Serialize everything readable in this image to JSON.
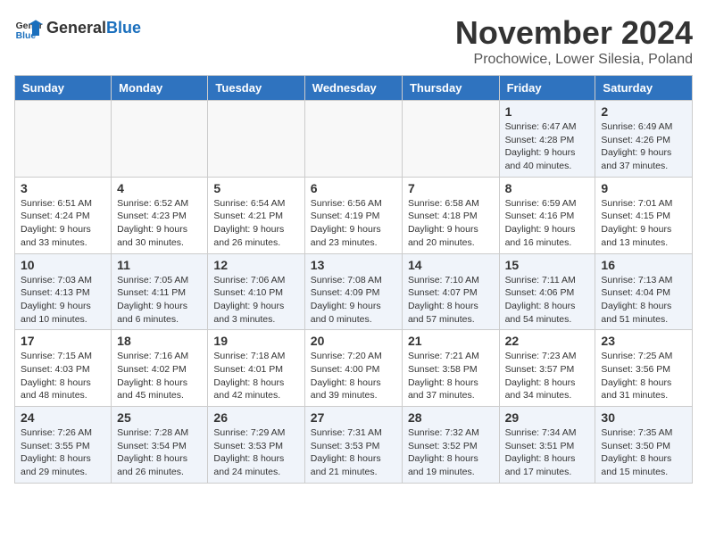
{
  "header": {
    "logo_line1": "General",
    "logo_line2": "Blue",
    "month": "November 2024",
    "location": "Prochowice, Lower Silesia, Poland"
  },
  "weekdays": [
    "Sunday",
    "Monday",
    "Tuesday",
    "Wednesday",
    "Thursday",
    "Friday",
    "Saturday"
  ],
  "weeks": [
    [
      {
        "day": "",
        "info": ""
      },
      {
        "day": "",
        "info": ""
      },
      {
        "day": "",
        "info": ""
      },
      {
        "day": "",
        "info": ""
      },
      {
        "day": "",
        "info": ""
      },
      {
        "day": "1",
        "info": "Sunrise: 6:47 AM\nSunset: 4:28 PM\nDaylight: 9 hours\nand 40 minutes."
      },
      {
        "day": "2",
        "info": "Sunrise: 6:49 AM\nSunset: 4:26 PM\nDaylight: 9 hours\nand 37 minutes."
      }
    ],
    [
      {
        "day": "3",
        "info": "Sunrise: 6:51 AM\nSunset: 4:24 PM\nDaylight: 9 hours\nand 33 minutes."
      },
      {
        "day": "4",
        "info": "Sunrise: 6:52 AM\nSunset: 4:23 PM\nDaylight: 9 hours\nand 30 minutes."
      },
      {
        "day": "5",
        "info": "Sunrise: 6:54 AM\nSunset: 4:21 PM\nDaylight: 9 hours\nand 26 minutes."
      },
      {
        "day": "6",
        "info": "Sunrise: 6:56 AM\nSunset: 4:19 PM\nDaylight: 9 hours\nand 23 minutes."
      },
      {
        "day": "7",
        "info": "Sunrise: 6:58 AM\nSunset: 4:18 PM\nDaylight: 9 hours\nand 20 minutes."
      },
      {
        "day": "8",
        "info": "Sunrise: 6:59 AM\nSunset: 4:16 PM\nDaylight: 9 hours\nand 16 minutes."
      },
      {
        "day": "9",
        "info": "Sunrise: 7:01 AM\nSunset: 4:15 PM\nDaylight: 9 hours\nand 13 minutes."
      }
    ],
    [
      {
        "day": "10",
        "info": "Sunrise: 7:03 AM\nSunset: 4:13 PM\nDaylight: 9 hours\nand 10 minutes."
      },
      {
        "day": "11",
        "info": "Sunrise: 7:05 AM\nSunset: 4:11 PM\nDaylight: 9 hours\nand 6 minutes."
      },
      {
        "day": "12",
        "info": "Sunrise: 7:06 AM\nSunset: 4:10 PM\nDaylight: 9 hours\nand 3 minutes."
      },
      {
        "day": "13",
        "info": "Sunrise: 7:08 AM\nSunset: 4:09 PM\nDaylight: 9 hours\nand 0 minutes."
      },
      {
        "day": "14",
        "info": "Sunrise: 7:10 AM\nSunset: 4:07 PM\nDaylight: 8 hours\nand 57 minutes."
      },
      {
        "day": "15",
        "info": "Sunrise: 7:11 AM\nSunset: 4:06 PM\nDaylight: 8 hours\nand 54 minutes."
      },
      {
        "day": "16",
        "info": "Sunrise: 7:13 AM\nSunset: 4:04 PM\nDaylight: 8 hours\nand 51 minutes."
      }
    ],
    [
      {
        "day": "17",
        "info": "Sunrise: 7:15 AM\nSunset: 4:03 PM\nDaylight: 8 hours\nand 48 minutes."
      },
      {
        "day": "18",
        "info": "Sunrise: 7:16 AM\nSunset: 4:02 PM\nDaylight: 8 hours\nand 45 minutes."
      },
      {
        "day": "19",
        "info": "Sunrise: 7:18 AM\nSunset: 4:01 PM\nDaylight: 8 hours\nand 42 minutes."
      },
      {
        "day": "20",
        "info": "Sunrise: 7:20 AM\nSunset: 4:00 PM\nDaylight: 8 hours\nand 39 minutes."
      },
      {
        "day": "21",
        "info": "Sunrise: 7:21 AM\nSunset: 3:58 PM\nDaylight: 8 hours\nand 37 minutes."
      },
      {
        "day": "22",
        "info": "Sunrise: 7:23 AM\nSunset: 3:57 PM\nDaylight: 8 hours\nand 34 minutes."
      },
      {
        "day": "23",
        "info": "Sunrise: 7:25 AM\nSunset: 3:56 PM\nDaylight: 8 hours\nand 31 minutes."
      }
    ],
    [
      {
        "day": "24",
        "info": "Sunrise: 7:26 AM\nSunset: 3:55 PM\nDaylight: 8 hours\nand 29 minutes."
      },
      {
        "day": "25",
        "info": "Sunrise: 7:28 AM\nSunset: 3:54 PM\nDaylight: 8 hours\nand 26 minutes."
      },
      {
        "day": "26",
        "info": "Sunrise: 7:29 AM\nSunset: 3:53 PM\nDaylight: 8 hours\nand 24 minutes."
      },
      {
        "day": "27",
        "info": "Sunrise: 7:31 AM\nSunset: 3:53 PM\nDaylight: 8 hours\nand 21 minutes."
      },
      {
        "day": "28",
        "info": "Sunrise: 7:32 AM\nSunset: 3:52 PM\nDaylight: 8 hours\nand 19 minutes."
      },
      {
        "day": "29",
        "info": "Sunrise: 7:34 AM\nSunset: 3:51 PM\nDaylight: 8 hours\nand 17 minutes."
      },
      {
        "day": "30",
        "info": "Sunrise: 7:35 AM\nSunset: 3:50 PM\nDaylight: 8 hours\nand 15 minutes."
      }
    ]
  ]
}
